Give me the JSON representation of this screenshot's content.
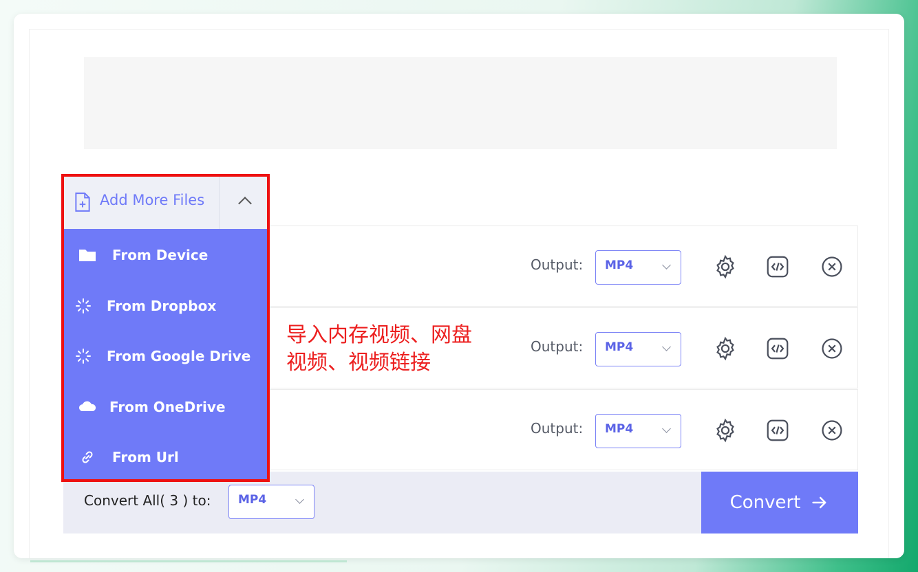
{
  "add_more": {
    "label": "Add More Files"
  },
  "menu": [
    {
      "label": "From Device",
      "icon": "folder-icon"
    },
    {
      "label": "From Dropbox",
      "icon": "loading-spinner-icon"
    },
    {
      "label": "From Google Drive",
      "icon": "loading-spinner-icon"
    },
    {
      "label": "From OneDrive",
      "icon": "cloud-icon"
    },
    {
      "label": "From Url",
      "icon": "link-icon"
    }
  ],
  "files": [
    {
      "output_label": "Output:",
      "format": "MP4"
    },
    {
      "output_label": "Output:",
      "format": "MP4"
    },
    {
      "output_label": "Output:",
      "format": "MP4"
    }
  ],
  "annotation": {
    "line1": "导入内存视频、网盘",
    "line2": "视频、视频链接"
  },
  "footer": {
    "convert_all_label": "Convert All( 3 ) to:",
    "format": "MP4",
    "convert_label": "Convert"
  },
  "colors": {
    "accent": "#6f7af8",
    "highlight": "#ee1111",
    "annotation": "#ec1f1f"
  }
}
